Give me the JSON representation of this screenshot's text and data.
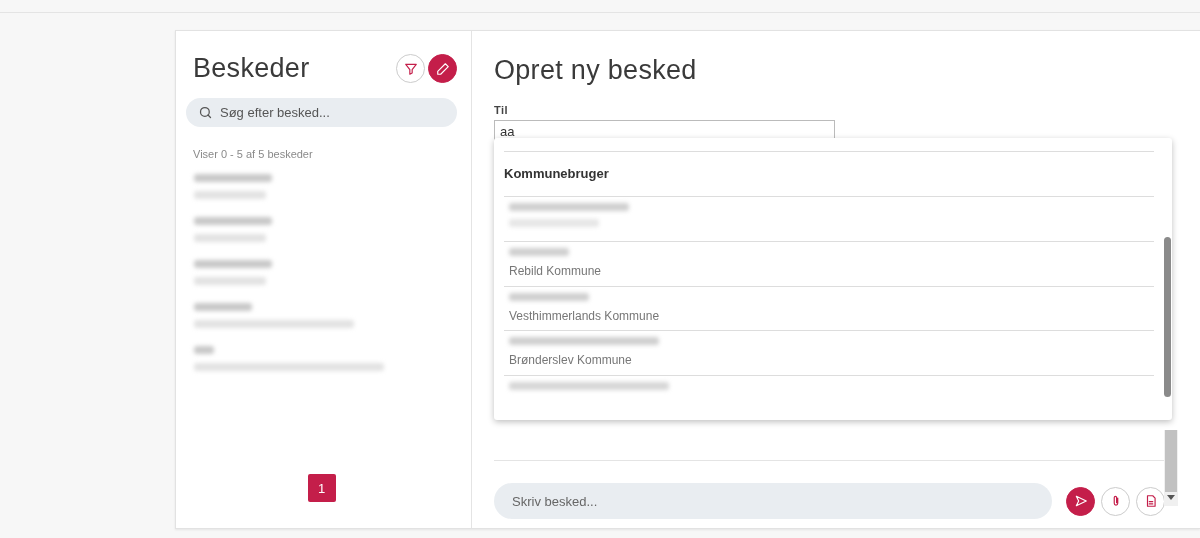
{
  "sidebar": {
    "title": "Beskeder",
    "search": {
      "placeholder": "Søg efter besked..."
    },
    "count": "Viser 0 - 5 af 5 beskeder",
    "messages": [
      {
        "kind": "redacted"
      },
      {
        "kind": "redacted"
      },
      {
        "kind": "redacted"
      },
      {
        "kind": "redacted"
      },
      {
        "kind": "redacted"
      }
    ],
    "pagination": [
      {
        "label": "1",
        "selected": true
      }
    ]
  },
  "compose": {
    "title": "Opret ny besked",
    "to_label": "Til",
    "to_value": "aa",
    "suggestions": {
      "group": "Kommunebruger",
      "options": [
        {
          "subtitle_redacted": true
        },
        {
          "subtitle": "Rebild Kommune"
        },
        {
          "subtitle": "Vesthimmerlands Kommune"
        },
        {
          "subtitle": "Brønderslev Kommune"
        },
        {
          "cut": true
        }
      ]
    },
    "message": {
      "placeholder": "Skriv besked..."
    }
  }
}
